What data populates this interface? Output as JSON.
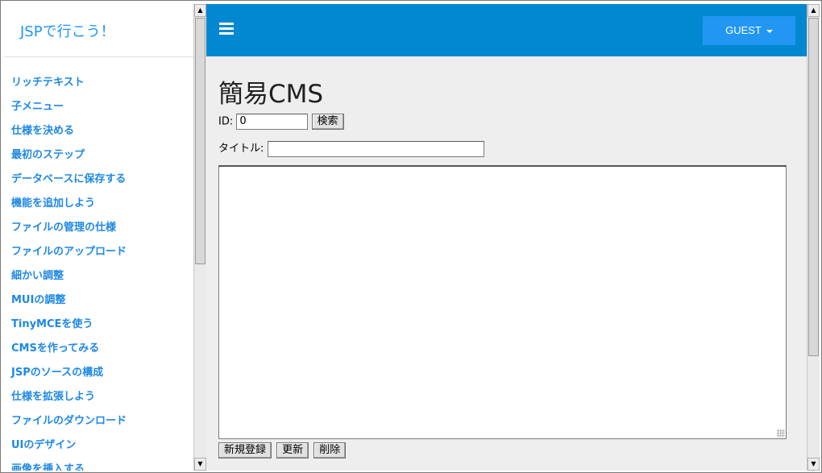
{
  "brand": "JSPで行こう！",
  "nav": [
    "リッチテキスト",
    "子メニュー",
    "仕様を決める",
    "最初のステップ",
    "データベースに保存する",
    "機能を追加しよう",
    "ファイルの管理の仕様",
    "ファイルのアップロード",
    "細かい調整",
    "MUIの調整",
    "TinyMCEを使う",
    "CMSを作ってみる",
    "JSPのソースの構成",
    "仕様を拡張しよう",
    "ファイルのダウンロード",
    "UIのデザイン",
    "画像を挿入する"
  ],
  "topbar": {
    "menu_icon": "hamburger-icon",
    "user_label": "GUEST"
  },
  "page": {
    "title": "簡易CMS",
    "id_label": "ID:",
    "id_value": "0",
    "search_label": "検索",
    "title_label": "タイトル:",
    "title_value": "",
    "body_value": "",
    "create_label": "新規登録",
    "update_label": "更新",
    "delete_label": "削除"
  },
  "colors": {
    "topbar": "#0288d1",
    "accent": "#2196f3",
    "link": "#1e88e5",
    "background": "#eeeeee"
  }
}
